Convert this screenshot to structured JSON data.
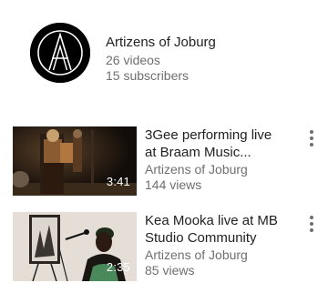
{
  "channel": {
    "name": "Artizens of Joburg",
    "videos": "26 videos",
    "subscribers": "15 subscribers",
    "avatar_icon": "artizens-logo-icon",
    "avatar_color": "#000000"
  },
  "videos": [
    {
      "title_line1": "3Gee performing live",
      "title_line2": "at Braam Music...",
      "channel": "Artizens of Joburg",
      "views": "144 views",
      "duration": "3:41",
      "menu_icon": "more-vert-icon"
    },
    {
      "title_line1": "Kea Mooka live at MB",
      "title_line2": "Studio Community",
      "channel": "Artizens of Joburg",
      "views": "85 views",
      "duration": "2:35",
      "menu_icon": "more-vert-icon"
    }
  ],
  "colors": {
    "primary_text": "#212121",
    "secondary_text": "#6f6f6f",
    "background": "#ffffff"
  }
}
